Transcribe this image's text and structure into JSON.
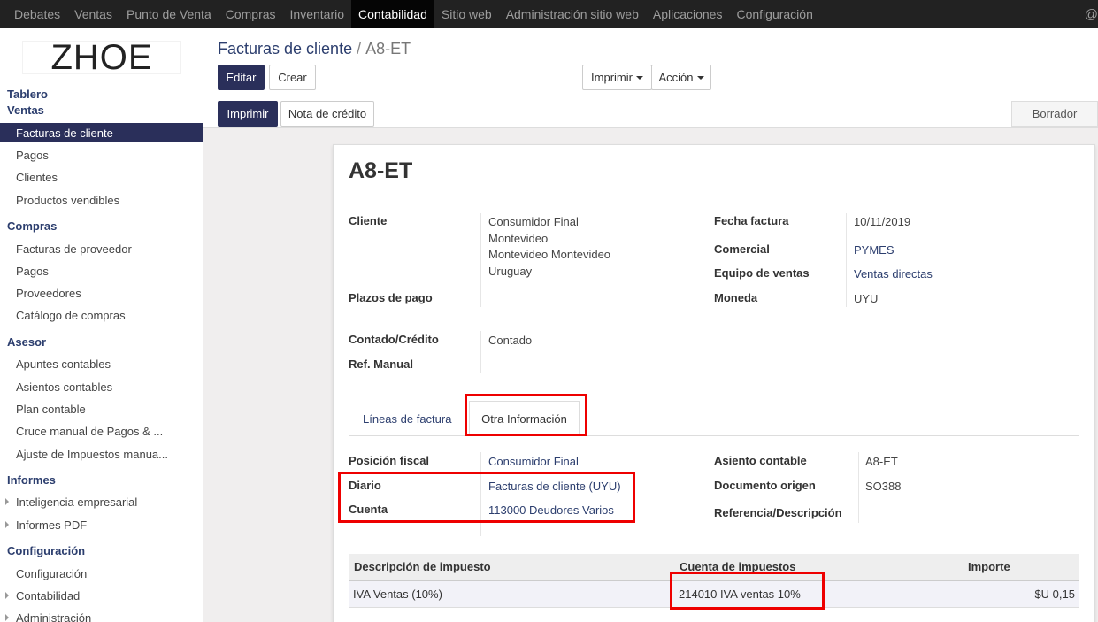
{
  "topbar": {
    "menu": [
      "Debates",
      "Ventas",
      "Punto de Venta",
      "Compras",
      "Inventario",
      "Contabilidad",
      "Sitio web",
      "Administración sitio web",
      "Aplicaciones",
      "Configuración"
    ],
    "active": "Contabilidad",
    "right_glyph": "@"
  },
  "sidebar": {
    "logo_text": "ZHOE",
    "tablero": "Tablero",
    "ventas": "Ventas",
    "ventas_items": [
      "Facturas de cliente",
      "Pagos",
      "Clientes",
      "Productos vendibles"
    ],
    "compras": "Compras",
    "compras_items": [
      "Facturas de proveedor",
      "Pagos",
      "Proveedores",
      "Catálogo de compras"
    ],
    "asesor": "Asesor",
    "asesor_items": [
      "Apuntes contables",
      "Asientos contables",
      "Plan contable",
      "Cruce manual de Pagos & ...",
      "Ajuste de Impuestos manua..."
    ],
    "informes": "Informes",
    "informes_items": [
      "Inteligencia empresarial",
      "Informes PDF"
    ],
    "configuracion": "Configuración",
    "configuracion_items": [
      "Configuración",
      "Contabilidad",
      "Administración"
    ]
  },
  "breadcrumb": {
    "parent": "Facturas de cliente",
    "separator": "/",
    "current": "A8-ET"
  },
  "buttons": {
    "editar": "Editar",
    "crear": "Crear",
    "imprimir_dropdown": "Imprimir",
    "accion": "Acción",
    "imprimir": "Imprimir",
    "nota_credito": "Nota de crédito"
  },
  "status": "Borrador",
  "invoice": {
    "number": "A8-ET",
    "cliente_label": "Cliente",
    "cliente_lines": [
      "Consumidor Final",
      "Montevideo",
      "Montevideo Montevideo",
      "Uruguay"
    ],
    "plazos_label": "Plazos de pago",
    "fecha_label": "Fecha factura",
    "fecha": "10/11/2019",
    "comercial_label": "Comercial",
    "comercial": "PYMES",
    "equipo_label": "Equipo de ventas",
    "equipo": "Ventas directas",
    "moneda_label": "Moneda",
    "moneda": "UYU",
    "contado_label": "Contado/Crédito",
    "contado": "Contado",
    "ref_label": "Ref. Manual"
  },
  "tabs": {
    "lineas": "Líneas de factura",
    "otra": "Otra Información"
  },
  "otra_info": {
    "posicion_label": "Posición fiscal",
    "posicion": "Consumidor Final",
    "diario_label": "Diario",
    "diario": "Facturas de cliente (UYU)",
    "cuenta_label": "Cuenta",
    "cuenta": "113000 Deudores Varios",
    "asiento_label": "Asiento contable",
    "asiento": "A8-ET",
    "origen_label": "Documento origen",
    "origen": "SO388",
    "referencia_label": "Referencia/Descripción"
  },
  "tax_table": {
    "headers": [
      "Descripción de impuesto",
      "Cuenta de impuestos",
      "Importe"
    ],
    "rows": [
      [
        "IVA Ventas (10%)",
        "214010 IVA ventas 10%",
        "$U 0,15"
      ]
    ]
  },
  "colors": {
    "brand": "#2a2f5a",
    "highlight": "#e00000",
    "topbar": "#222222"
  }
}
